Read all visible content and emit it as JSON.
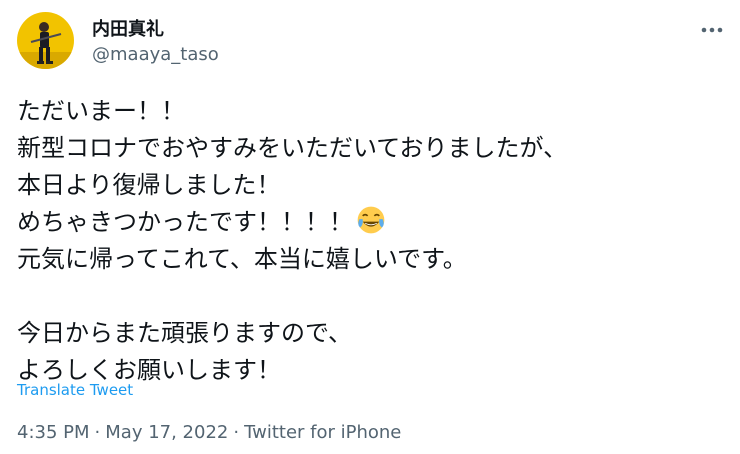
{
  "author": {
    "display_name": "内田真礼",
    "handle": "@maaya_taso",
    "avatar_icon": "user-avatar-photo"
  },
  "more_icon": "more-options-icon",
  "tweet": {
    "lines": [
      "ただいまー！！",
      "新型コロナでおやすみをいただいておりましたが、",
      "本日より復帰しました！",
      "めちゃきつかったです！！！！",
      "元気に帰ってこれて、本当に嬉しいです。",
      "",
      "今日からまた頑張りますので、",
      "よろしくお願いします！"
    ],
    "emoji": "face-with-tears-of-joy-emoji"
  },
  "translate_label": "Translate Tweet",
  "meta": {
    "time": "4:35 PM",
    "separator": "·",
    "date": "May 17, 2022",
    "source": "Twitter for iPhone"
  },
  "colors": {
    "text": "#0f1419",
    "secondary": "#536471",
    "link": "#1d9bf0",
    "avatar_bg": "#f2c300"
  }
}
